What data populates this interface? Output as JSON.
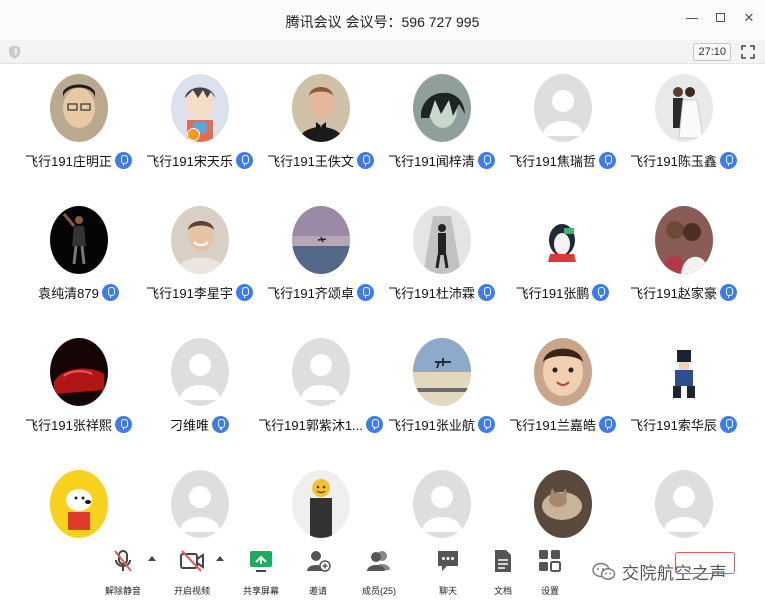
{
  "window": {
    "title": "腾讯会议 会议号：596 727 995",
    "timer": "27:10"
  },
  "participants": [
    {
      "name": "飞行191庄明正",
      "avatar": "photo-boy-glasses",
      "host": false
    },
    {
      "name": "飞行191宋天乐",
      "avatar": "cartoon-character",
      "host": true
    },
    {
      "name": "飞行191王佚文",
      "avatar": "photo-man-bowtie",
      "host": false
    },
    {
      "name": "飞行191闻梓清",
      "avatar": "anime-dark-hair",
      "host": false
    },
    {
      "name": "飞行191焦瑞哲",
      "avatar": "default-silhouette",
      "host": false
    },
    {
      "name": "飞行191陈玉鑫",
      "avatar": "photo-wedding",
      "host": false
    },
    {
      "name": "袁纯清879",
      "avatar": "photo-basketball-dark",
      "host": false
    },
    {
      "name": "飞行191李星宇",
      "avatar": "photo-smiling-hoodie",
      "host": false
    },
    {
      "name": "飞行191齐颂卓",
      "avatar": "photo-sky-plane",
      "host": false
    },
    {
      "name": "飞行191杜沛霖",
      "avatar": "photo-player-bw",
      "host": false
    },
    {
      "name": "飞行191张鹏",
      "avatar": "cartoon-penguin",
      "host": false
    },
    {
      "name": "飞行191赵家豪",
      "avatar": "photo-two-people",
      "host": false
    },
    {
      "name": "飞行191张祥熙",
      "avatar": "photo-red-car",
      "host": false
    },
    {
      "name": "刁维唯",
      "avatar": "default-silhouette",
      "host": false
    },
    {
      "name": "飞行191郭紫沐1...",
      "avatar": "default-silhouette",
      "host": false
    },
    {
      "name": "飞行191张业航",
      "avatar": "photo-airplane-sky",
      "host": false
    },
    {
      "name": "飞行191兰嘉皓",
      "avatar": "photo-child-face",
      "host": false
    },
    {
      "name": "飞行191索华辰",
      "avatar": "pixel-anime",
      "host": false
    },
    {
      "name": "",
      "avatar": "cartoon-dog-yellow",
      "host": false
    },
    {
      "name": "",
      "avatar": "default-silhouette",
      "host": false
    },
    {
      "name": "",
      "avatar": "photo-person-emoji",
      "host": false
    },
    {
      "name": "",
      "avatar": "default-silhouette",
      "host": false
    },
    {
      "name": "",
      "avatar": "photo-cat",
      "host": false
    },
    {
      "name": "",
      "avatar": "default-silhouette",
      "host": false
    }
  ],
  "toolbar": {
    "mute_label": "解除静音",
    "video_label": "开启视频",
    "share_label": "共享屏幕",
    "invite_label": "邀请",
    "members_label": "成员(25)",
    "chat_label": "聊天",
    "docs_label": "文档",
    "settings_label": "设置",
    "watermark": "交院航空之声"
  },
  "colors": {
    "mic_blue": "#3d7cf0",
    "share_green": "#1aad5b",
    "mute_red": "#e45a5a",
    "placeholder_gray": "#d9d9d9"
  }
}
